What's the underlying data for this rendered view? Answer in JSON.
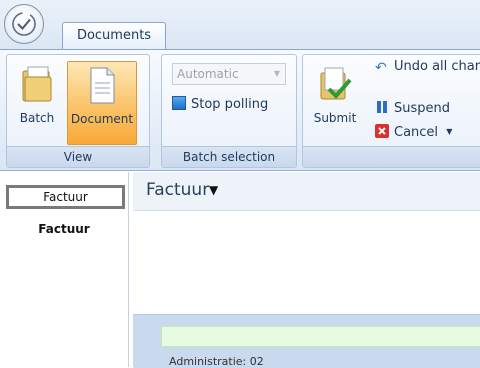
{
  "tabs": [
    {
      "label": "Documents"
    }
  ],
  "ribbon": {
    "view": {
      "label": "View",
      "batch_label": "Batch",
      "document_label": "Document"
    },
    "batch_selection": {
      "label": "Batch selection",
      "mode_value": "Automatic",
      "stop_polling_label": "Stop polling"
    },
    "actions": {
      "submit_label": "Submit",
      "undo_label": "Undo all char",
      "suspend_label": "Suspend",
      "cancel_label": "Cancel"
    }
  },
  "left_list": {
    "selected_item": "Factuur",
    "heading": "Factuur"
  },
  "main": {
    "title": "Factuur",
    "caret": "▼",
    "administration": "Administratie:   02"
  },
  "colors": {
    "ribbon_bg": "#e7effa",
    "active_button": "#fbc66e",
    "panel_blue": "#c9d9ee",
    "green_bar": "#e6fbe0"
  }
}
